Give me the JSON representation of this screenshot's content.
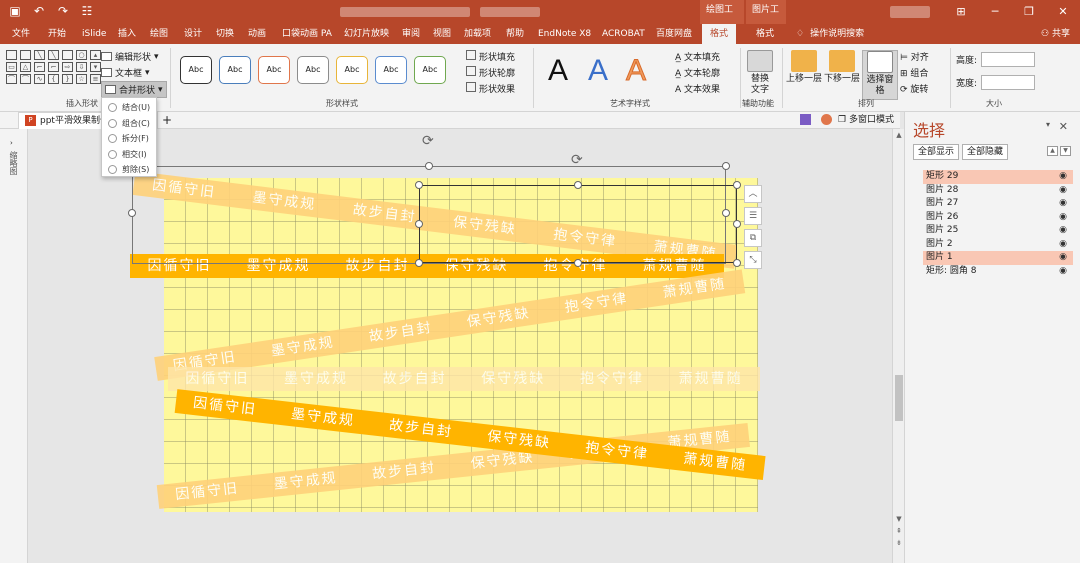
{
  "window": {
    "context_tab_drawing": "绘图工具",
    "context_tab_picture": "图片工具",
    "share": "共享"
  },
  "tabs": [
    "文件",
    "开始",
    "iSlide",
    "插入",
    "绘图",
    "设计",
    "切换",
    "动画",
    "口袋动画 PA",
    "幻灯片放映",
    "审阅",
    "视图",
    "加载项",
    "帮助",
    "EndNote X8",
    "ACROBAT",
    "百度网盘",
    "格式",
    "格式"
  ],
  "tell_me": "操作说明搜索",
  "ribbon": {
    "insert_shapes": {
      "label": "插入形状",
      "edit_shape": "编辑形状",
      "textbox": "文本框",
      "merge_shapes": "合并形状"
    },
    "shape_styles": {
      "label": "形状样式",
      "sample": "Abc",
      "style_colors": [
        "#333333",
        "#4a7ebb",
        "#e0764b",
        "#8c8c8c",
        "#e8b53a",
        "#5b8ccf",
        "#70a850"
      ],
      "fill": "形状填充",
      "outline": "形状轮廓",
      "effects": "形状效果"
    },
    "wordart": {
      "label": "艺术字样式",
      "sample": "A",
      "text_fill": "文本填充",
      "text_outline": "文本轮廓",
      "text_effects": "文本效果"
    },
    "accessibility": {
      "label": "辅助功能",
      "alt_text": "替换文字"
    },
    "arrange": {
      "label": "排列",
      "bring_forward": "上移一层",
      "send_backward": "下移一层",
      "selection_pane": "选择窗格",
      "align": "对齐",
      "group": "组合",
      "rotate": "旋转"
    },
    "size": {
      "label": "大小",
      "height": "高度:",
      "width": "宽度:"
    }
  },
  "merge_menu": [
    "结合(U)",
    "组合(C)",
    "拆分(F)",
    "相交(I)",
    "剪除(S)"
  ],
  "document": {
    "tab_title": "ppt平滑效果制作",
    "multi_window": "多窗口模式",
    "thumbnails_label": "缩略图"
  },
  "slide": {
    "strip_words": [
      "因循守旧",
      "墨守成规",
      "故步自封",
      "保守残缺",
      "抱令守律",
      "萧规曹随"
    ]
  },
  "selection_pane": {
    "title": "选择",
    "show_all": "全部显示",
    "hide_all": "全部隐藏",
    "items": [
      {
        "name": "矩形 29",
        "highlighted": true
      },
      {
        "name": "图片 28",
        "highlighted": false
      },
      {
        "name": "图片 27",
        "highlighted": false
      },
      {
        "name": "图片 26",
        "highlighted": false
      },
      {
        "name": "图片 25",
        "highlighted": false
      },
      {
        "name": "图片 2",
        "highlighted": false
      },
      {
        "name": "图片 1",
        "highlighted": true
      },
      {
        "name": "矩形: 圆角 8",
        "highlighted": false
      }
    ]
  },
  "colors": {
    "accent": "#b7472a",
    "strip_orange": "#ffb400",
    "strip_light": "#ffd27a",
    "slide_bg": "#fef89b",
    "highlight": "#f9c7b4"
  }
}
